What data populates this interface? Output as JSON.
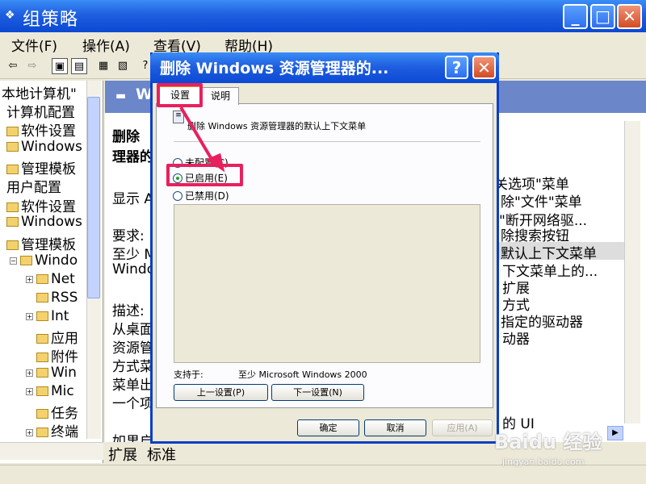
{
  "window": {
    "title": "组策略",
    "app_icon": "group-policy-icon",
    "minimize": "_",
    "maximize": "□",
    "close": "✕"
  },
  "menubar": [
    "文件(F)",
    "操作(A)",
    "查看(V)",
    "帮助(H)"
  ],
  "tree": {
    "items": [
      {
        "label": "本地计算机\"",
        "indent": 0,
        "icon": "none"
      },
      {
        "label": "计算机配置",
        "indent": 1,
        "icon": "computer-icon"
      },
      {
        "label": "软件设置",
        "indent": 1,
        "icon": "folder-icon"
      },
      {
        "label": "Windows",
        "indent": 1,
        "icon": "folder-icon"
      },
      {
        "label": "管理模板",
        "indent": 1,
        "icon": "folder-icon"
      },
      {
        "label": "用户配置",
        "indent": 0,
        "icon": "user-icon"
      },
      {
        "label": "软件设置",
        "indent": 1,
        "icon": "folder-icon"
      },
      {
        "label": "Windows",
        "indent": 1,
        "icon": "folder-icon"
      },
      {
        "label": "管理模板",
        "indent": 1,
        "icon": "folder-icon"
      },
      {
        "label": "Windo",
        "indent": 2,
        "icon": "folder-icon"
      },
      {
        "label": "Net",
        "indent": 3,
        "icon": "folder-icon"
      },
      {
        "label": "RSS",
        "indent": 3,
        "icon": "folder-icon"
      },
      {
        "label": "Int",
        "indent": 3,
        "icon": "folder-icon"
      },
      {
        "label": "应用",
        "indent": 3,
        "icon": "folder-icon"
      },
      {
        "label": "附件",
        "indent": 3,
        "icon": "folder-icon"
      },
      {
        "label": "Win",
        "indent": 3,
        "icon": "folder-icon"
      },
      {
        "label": "Mic",
        "indent": 3,
        "icon": "folder-icon"
      },
      {
        "label": "任务",
        "indent": 3,
        "icon": "folder-icon"
      },
      {
        "label": "终端",
        "indent": 3,
        "icon": "folder-icon"
      }
    ]
  },
  "right_pane": {
    "header": "Wi",
    "desc_lines": [
      "删除",
      "理器的",
      "显示 A",
      "要求:",
      "至少 M",
      "Windo",
      "描述:",
      "从桌面",
      "资源管",
      "方式菜",
      "菜单出",
      "一个项",
      "如果启"
    ],
    "list_lines": [
      "关选项\"菜单",
      "除\"文件\"菜单",
      "\"断开网络驱...",
      "除搜索按钮",
      "默认上下文菜单",
      "下文菜单上的...",
      "扩展",
      "方式",
      "指定的驱动器",
      "动器",
      "的 UI"
    ]
  },
  "bottom_tabs": [
    "扩展",
    "标准"
  ],
  "dialog": {
    "title": "删除 Windows 资源管理器的...",
    "help": "?",
    "close": "✕",
    "tabs": [
      "设置",
      "说明"
    ],
    "policy_name": "删除 Windows 资源管理器的默认上下文菜单",
    "radios": [
      {
        "label": "未配置(C)",
        "checked": false
      },
      {
        "label": "已启用(E)",
        "checked": true
      },
      {
        "label": "已禁用(D)",
        "checked": false
      }
    ],
    "supported_label": "支持于:",
    "supported_value": "至少 Microsoft Windows 2000",
    "prev_button": "上一设置(P)",
    "next_button": "下一设置(N)",
    "ok": "确定",
    "cancel": "取消",
    "apply": "应用(A)"
  },
  "watermark": {
    "brand": "Baidu 经验",
    "url": "jingyan.baidu.com"
  },
  "colors": {
    "titlebar": "#0b49d3",
    "highlight": "#e8205e",
    "tree_header": "#6b86c9"
  }
}
